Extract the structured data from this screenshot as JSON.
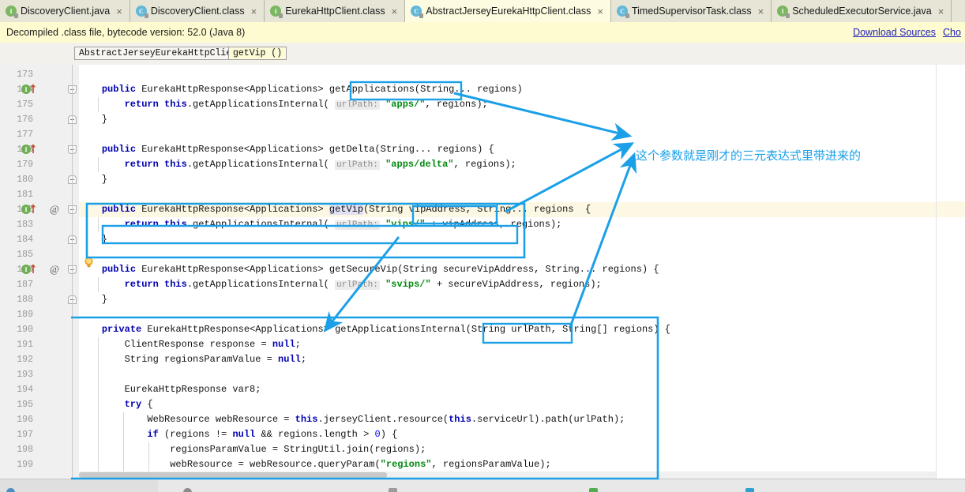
{
  "tabs": [
    {
      "label": "DiscoveryClient.java",
      "icon": "java-file-icon",
      "kind": "java",
      "active": false
    },
    {
      "label": "DiscoveryClient.class",
      "icon": "class-file-icon",
      "kind": "class",
      "active": false
    },
    {
      "label": "EurekaHttpClient.class",
      "icon": "java-file-icon",
      "kind": "java",
      "active": false
    },
    {
      "label": "AbstractJerseyEurekaHttpClient.class",
      "icon": "class-file-icon",
      "kind": "class",
      "active": true
    },
    {
      "label": "TimedSupervisorTask.class",
      "icon": "class-file-icon",
      "kind": "class",
      "active": false
    },
    {
      "label": "ScheduledExecutorService.java",
      "icon": "java-file-icon",
      "kind": "java",
      "active": false
    }
  ],
  "close_glyph": "×",
  "notification": {
    "text": "Decompiled .class file, bytecode version: 52.0 (Java 8)",
    "link_download": "Download Sources",
    "link_choose": "Cho"
  },
  "breadcrumb": {
    "class": "AbstractJerseyEurekaHttpClient",
    "method": "getVip ()"
  },
  "editor": {
    "first_line": 173,
    "caret_line": 182,
    "lines": [
      {
        "n": 173,
        "indent": 0,
        "html": ""
      },
      {
        "n": 174,
        "indent": 0,
        "html": "    <span class=\"kw\">public</span> EurekaHttpResponse&lt;Applications&gt; getApplications(String... regions)"
      },
      {
        "n": 175,
        "indent": 0,
        "html": "        <span class=\"kw\">return</span> <span class=\"kw\">this</span>.getApplicationsInternal( <span class=\"hint\">urlPath:</span> <span class=\"str\">\"apps/\"</span>, regions);"
      },
      {
        "n": 176,
        "indent": 0,
        "html": "    }"
      },
      {
        "n": 177,
        "indent": 0,
        "html": ""
      },
      {
        "n": 178,
        "indent": 0,
        "html": "    <span class=\"kw\">public</span> EurekaHttpResponse&lt;Applications&gt; getDelta(String... regions) {"
      },
      {
        "n": 179,
        "indent": 0,
        "html": "        <span class=\"kw\">return</span> <span class=\"kw\">this</span>.getApplicationsInternal( <span class=\"hint\">urlPath:</span> <span class=\"str\">\"apps/delta\"</span>, regions);"
      },
      {
        "n": 180,
        "indent": 0,
        "html": "    }"
      },
      {
        "n": 181,
        "indent": 0,
        "html": ""
      },
      {
        "n": 182,
        "indent": 0,
        "html": "    <span class=\"kw\">public</span> EurekaHttpResponse&lt;Applications&gt; <span class=\"hl\">getVip</span>(String vipAddress, String... regions  {"
      },
      {
        "n": 183,
        "indent": 0,
        "html": "        <span class=\"kw\">return</span> <span class=\"kw\">this</span>.getApplicationsInternal( <span class=\"hint\">urlPath:</span> <span class=\"str\">\"vips/\"</span> + vipAddress, regions);"
      },
      {
        "n": 184,
        "indent": 0,
        "html": "    }"
      },
      {
        "n": 185,
        "indent": 0,
        "html": ""
      },
      {
        "n": 186,
        "indent": 0,
        "html": "    <span class=\"kw\">public</span> EurekaHttpResponse&lt;Applications&gt; getSecureVip(String secureVipAddress, String... regions) {"
      },
      {
        "n": 187,
        "indent": 0,
        "html": "        <span class=\"kw\">return</span> <span class=\"kw\">this</span>.getApplicationsInternal( <span class=\"hint\">urlPath:</span> <span class=\"str\">\"svips/\"</span> + secureVipAddress, regions);"
      },
      {
        "n": 188,
        "indent": 0,
        "html": "    }"
      },
      {
        "n": 189,
        "indent": 0,
        "html": ""
      },
      {
        "n": 190,
        "indent": 0,
        "html": "    <span class=\"kw\">private</span> EurekaHttpResponse&lt;Applications&gt; getApplicationsInternal(String urlPath, String[] regions) {"
      },
      {
        "n": 191,
        "indent": 0,
        "html": "        ClientResponse response = <span class=\"kw\">null</span>;"
      },
      {
        "n": 192,
        "indent": 0,
        "html": "        String regionsParamValue = <span class=\"kw\">null</span>;"
      },
      {
        "n": 193,
        "indent": 0,
        "html": ""
      },
      {
        "n": 194,
        "indent": 0,
        "html": "        EurekaHttpResponse var8;"
      },
      {
        "n": 195,
        "indent": 0,
        "html": "        <span class=\"kw\">try</span> {"
      },
      {
        "n": 196,
        "indent": 0,
        "html": "            WebResource webResource = <span class=\"kw\">this</span>.jerseyClient.resource(<span class=\"kw\">this</span>.serviceUrl).path(urlPath);"
      },
      {
        "n": 197,
        "indent": 0,
        "html": "            <span class=\"kw\">if</span> (regions != <span class=\"kw\">null</span> &amp;&amp; regions.length &gt; <span class=\"num\">0</span>) {"
      },
      {
        "n": 198,
        "indent": 0,
        "html": "                regionsParamValue = StringUtil.join(regions);"
      },
      {
        "n": 199,
        "indent": 0,
        "html": "                webResource = webResource.queryParam(<span class=\"str\">\"regions\"</span>, regionsParamValue);"
      }
    ],
    "gutter_marks": [
      {
        "line": 174,
        "impl": true,
        "at": false
      },
      {
        "line": 178,
        "impl": true,
        "at": false
      },
      {
        "line": 182,
        "impl": true,
        "at": true
      },
      {
        "line": 186,
        "impl": true,
        "at": true
      }
    ]
  },
  "annotation": {
    "note": "这个参数就是刚才的三元表达式里带进来的",
    "color": "#1ba0e8"
  },
  "colors": {
    "accent_annotation": "#1ba0e8",
    "tab_active_bg": "#fdfbe0",
    "tab_bg": "#e6e5d6",
    "notification_bg": "#fdfbcf",
    "caret_line_bg": "#fdf8e3",
    "keyword": "#0000b0",
    "string": "#028a0f"
  }
}
